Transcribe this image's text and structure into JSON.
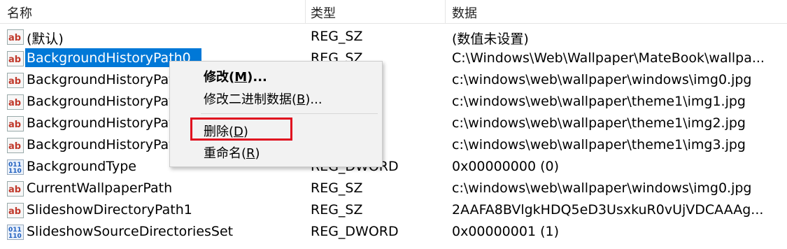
{
  "columns": {
    "name": "名称",
    "type": "类型",
    "data": "数据"
  },
  "rows": [
    {
      "icon": "string-value-icon",
      "name": "(默认)",
      "type": "REG_SZ",
      "data": "(数值未设置)"
    },
    {
      "icon": "string-value-icon",
      "name": "BackgroundHistoryPath0",
      "type": "REG_SZ",
      "data": "C:\\Windows\\Web\\Wallpaper\\MateBook\\wallpa...",
      "selected": true
    },
    {
      "icon": "string-value-icon",
      "name": "BackgroundHistoryPath1",
      "type": "REG_SZ",
      "data": "c:\\windows\\web\\wallpaper\\windows\\img0.jpg"
    },
    {
      "icon": "string-value-icon",
      "name": "BackgroundHistoryPath2",
      "type": "REG_SZ",
      "data": "c:\\windows\\web\\wallpaper\\theme1\\img1.jpg"
    },
    {
      "icon": "string-value-icon",
      "name": "BackgroundHistoryPath3",
      "type": "REG_SZ",
      "data": "c:\\windows\\web\\wallpaper\\theme1\\img2.jpg"
    },
    {
      "icon": "string-value-icon",
      "name": "BackgroundHistoryPath4",
      "type": "REG_SZ",
      "data": "c:\\windows\\web\\wallpaper\\theme1\\img3.jpg"
    },
    {
      "icon": "dword-value-icon",
      "name": "BackgroundType",
      "type": "REG_DWORD",
      "data": "0x00000000 (0)"
    },
    {
      "icon": "string-value-icon",
      "name": "CurrentWallpaperPath",
      "type": "REG_SZ",
      "data": "c:\\windows\\web\\wallpaper\\windows\\img0.jpg"
    },
    {
      "icon": "string-value-icon",
      "name": "SlideshowDirectoryPath1",
      "type": "REG_SZ",
      "data": "2AAFA8BVlgkHDQ5eD3UsxkuR0vUjVDCAAAg..."
    },
    {
      "icon": "dword-value-icon",
      "name": "SlideshowSourceDirectoriesSet",
      "type": "REG_DWORD",
      "data": "0x00000001 (1)"
    }
  ],
  "context_menu": {
    "items": [
      {
        "label": "修改(",
        "key": "M",
        "suffix": ")...",
        "bold": true
      },
      {
        "label": "修改二进制数据(",
        "key": "B",
        "suffix": ")..."
      },
      {
        "separator": true
      },
      {
        "label": "删除(",
        "key": "D",
        "suffix": ")",
        "highlighted": true
      },
      {
        "label": "重命名(",
        "key": "R",
        "suffix": ")"
      }
    ]
  },
  "colors": {
    "selection": "#0078d7",
    "highlight_box": "#e0101f",
    "menu_bg": "#f2f2f2",
    "string_icon_red": "#c0392b",
    "dword_icon_blue": "#1f5fbf"
  }
}
